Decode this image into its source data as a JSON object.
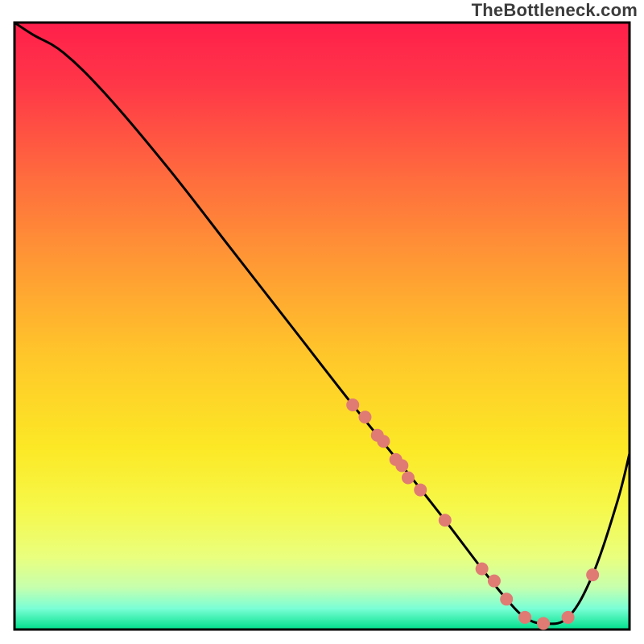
{
  "watermark": "TheBottleneck.com",
  "colors": {
    "marker_fill": "#e07b74",
    "curve": "#000000",
    "border": "#000000"
  },
  "chart_data": {
    "type": "line",
    "title": "",
    "xlabel": "",
    "ylabel": "",
    "xlim": [
      0,
      100
    ],
    "ylim": [
      0,
      100
    ],
    "grid": false,
    "legend": false,
    "gradient_stops": [
      {
        "offset": 0.0,
        "color": "#ff1f4b"
      },
      {
        "offset": 0.1,
        "color": "#ff3648"
      },
      {
        "offset": 0.25,
        "color": "#ff6a3e"
      },
      {
        "offset": 0.4,
        "color": "#ff9a34"
      },
      {
        "offset": 0.55,
        "color": "#ffc72a"
      },
      {
        "offset": 0.7,
        "color": "#fce825"
      },
      {
        "offset": 0.8,
        "color": "#f6f84a"
      },
      {
        "offset": 0.88,
        "color": "#eaff7d"
      },
      {
        "offset": 0.93,
        "color": "#c7ffad"
      },
      {
        "offset": 0.965,
        "color": "#7bffd6"
      },
      {
        "offset": 1.0,
        "color": "#00e08c"
      }
    ],
    "series": [
      {
        "name": "bottleneck-curve",
        "x": [
          0,
          3,
          8,
          15,
          25,
          35,
          45,
          55,
          63,
          70,
          76,
          80,
          83,
          86,
          90,
          94,
          98,
          100
        ],
        "y": [
          100,
          98,
          95,
          88,
          76,
          63,
          50,
          37,
          27,
          18,
          10,
          5,
          2,
          1,
          2,
          9,
          21,
          29
        ]
      }
    ],
    "markers": {
      "name": "highlighted-points",
      "x": [
        55,
        57,
        59,
        60,
        62,
        63,
        64,
        66,
        70,
        76,
        78,
        80,
        83,
        86,
        90,
        94
      ],
      "y": [
        37,
        35,
        32,
        31,
        28,
        27,
        25,
        23,
        18,
        10,
        8,
        5,
        2,
        1,
        2,
        9
      ]
    }
  }
}
